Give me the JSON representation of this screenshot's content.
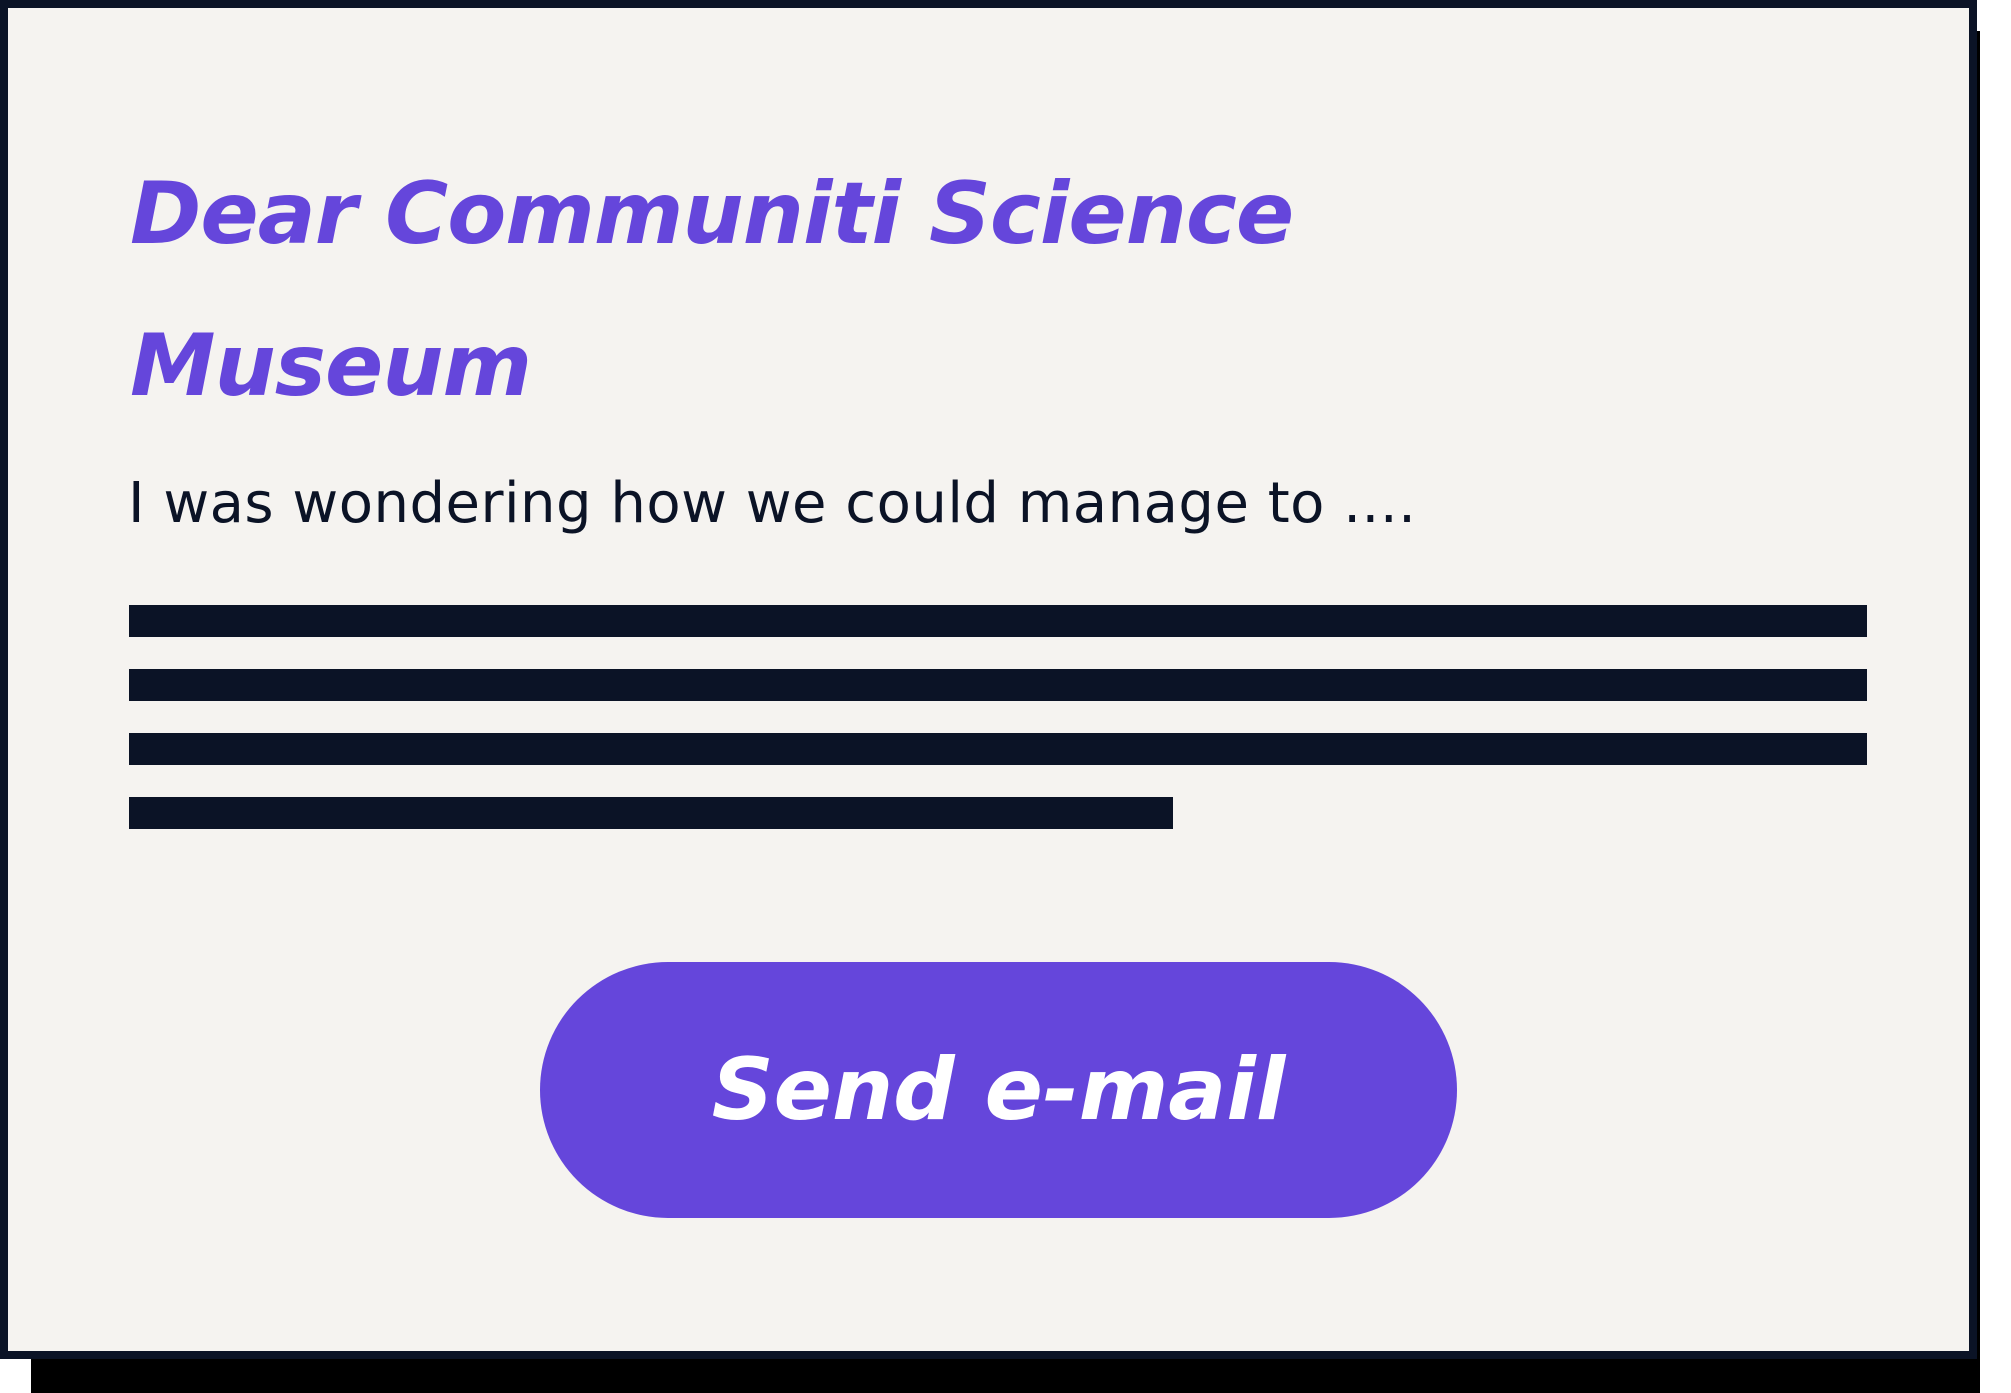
{
  "card": {
    "heading": "Dear Communiti Science Museum",
    "intro": "I was wondering how we could manage to ....",
    "body_placeholder_lines": 4
  },
  "actions": {
    "send_label": "Send e-mail"
  },
  "colors": {
    "accent": "#6546db",
    "text": "#0b1326",
    "card_background": "#f5f3f0",
    "shadow": "#000000"
  }
}
